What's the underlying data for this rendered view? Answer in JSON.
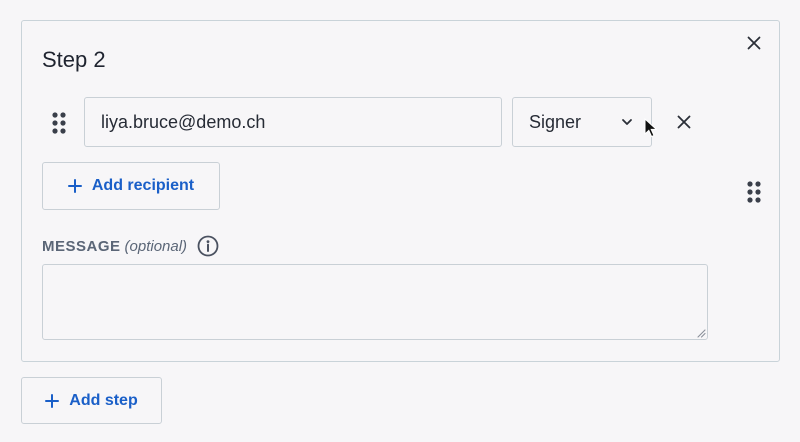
{
  "step": {
    "title": "Step 2",
    "close_icon": "close-icon"
  },
  "recipient": {
    "email": "liya.bruce@demo.ch",
    "role": "Signer",
    "drag_icon": "drag-handle-icon",
    "select_icon": "chevron-down-icon",
    "remove_icon": "close-icon"
  },
  "add_recipient": {
    "label": "Add recipient",
    "icon": "plus-icon"
  },
  "message": {
    "label": "MESSAGE",
    "optional": "(optional)",
    "info_icon": "info-icon",
    "value": ""
  },
  "add_step": {
    "label": "Add step",
    "icon": "plus-icon"
  },
  "colors": {
    "accent": "#1a5fc8",
    "border": "#c9d3d9",
    "background": "#f7f6f8",
    "text": "#1f2430",
    "muted": "#5b6677"
  }
}
